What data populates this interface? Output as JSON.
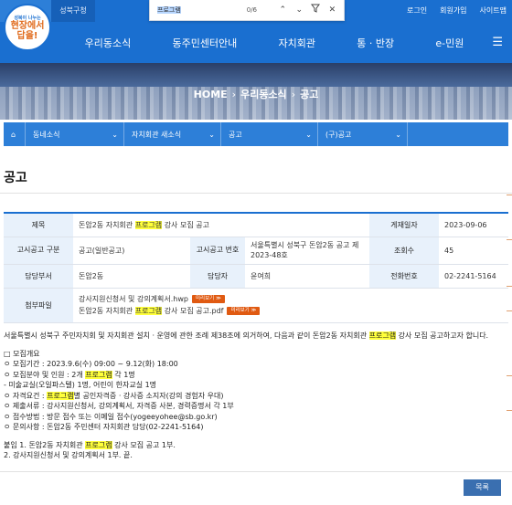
{
  "topbar": {
    "home_tab": "홈으로",
    "sb_tab": "성북구청",
    "links": [
      "로그인",
      "회원가입",
      "사이트맵"
    ]
  },
  "find": {
    "query": "프로그램",
    "count": "0/6",
    "icons": [
      "chevron-up-icon",
      "chevron-down-icon",
      "filter-icon",
      "close-icon"
    ]
  },
  "logo": {
    "small_text": "성북이 나누는",
    "text_line1": "현장에서",
    "text_line2": "답을!"
  },
  "gnb": [
    "우리동소식",
    "동주민센터안내",
    "자치회관",
    "통 · 반장",
    "e-민원"
  ],
  "breadcrumb": {
    "home": "HOME",
    "level1": "우리동소식",
    "level2": "공고"
  },
  "subnav": [
    "동네소식",
    "자치회관 새소식",
    "공고",
    "(구)공고"
  ],
  "page_title": "공고",
  "info": {
    "title_label": "제목",
    "title_pre": "돈암2동 자치회관 ",
    "title_hl": "프로그램",
    "title_post": " 강사 모집 공고",
    "date_label": "게재일자",
    "date_value": "2023-09-06",
    "type_label": "고시공고 구분",
    "type_value": "공고(일반공고)",
    "no_label": "고시공고 번호",
    "no_value": "서울특별시 성북구 돈암2동 공고 제2023-48호",
    "views_label": "조회수",
    "views_value": "45",
    "dept_label": "담당부서",
    "dept_value": "돈암2동",
    "person_label": "담당자",
    "person_value": "윤여희",
    "phone_label": "전화번호",
    "phone_value": "02-2241-5164",
    "attach_label": "첨부파일",
    "attach1": "강사지원신청서 및 강의계획서.hwp",
    "attach2_pre": "돈암2동 자치회관 ",
    "attach2_hl": "프로그램",
    "attach2_post": " 강사 모집 공고.pdf",
    "view_btn": "미리보기 ≫"
  },
  "content": {
    "intro_pre": "서울특별시 성북구 주민자치회 및 자치회관 설치 · 운영에 관한 조례 제38조에 의거하여, 다음과 같이 돈암2동 자치회관 ",
    "intro_hl": "프로그램",
    "intro_post": " 강사 모집 공고하고자 합니다.",
    "overview": "□ 모집개요",
    "period": "ㅇ 모집기간 : 2023.9.6(수) 09:00 ~ 9.12(화) 18:00",
    "field_pre": "ㅇ 모집분야 및 인원 : 2개 ",
    "field_hl": "프로그램",
    "field_post": " 각 1명",
    "field_detail": " - 미술교실(오일파스텔) 1명, 어린이 한자교실 1명",
    "qual_pre": "ㅇ 자격요건 : ",
    "qual_hl": "프로그램",
    "qual_post": "별 공인자격증 · 강사증 소지자(강의 경험자 우대)",
    "docs": "ㅇ 제출서류 : 강사지원신청서, 강의계획서, 자격증 사본, 경력증명서 각 1부",
    "method": "ㅇ 접수방법 : 방문 접수 또는 이메일 접수(yogeeyohee@sb.go.kr)",
    "contact": "ㅇ 문의사항 : 돈암2동 주민센터 자치회관 담당(02-2241-5164)",
    "annex1_pre": "붙임 1. 돈암2동 자치회관 ",
    "annex1_hl": "프로그램",
    "annex1_post": " 강사 모집 공고 1부.",
    "annex2": "2. 강사지원신청서 및 강의계획서 1부. 끝."
  },
  "list_button": "목록"
}
